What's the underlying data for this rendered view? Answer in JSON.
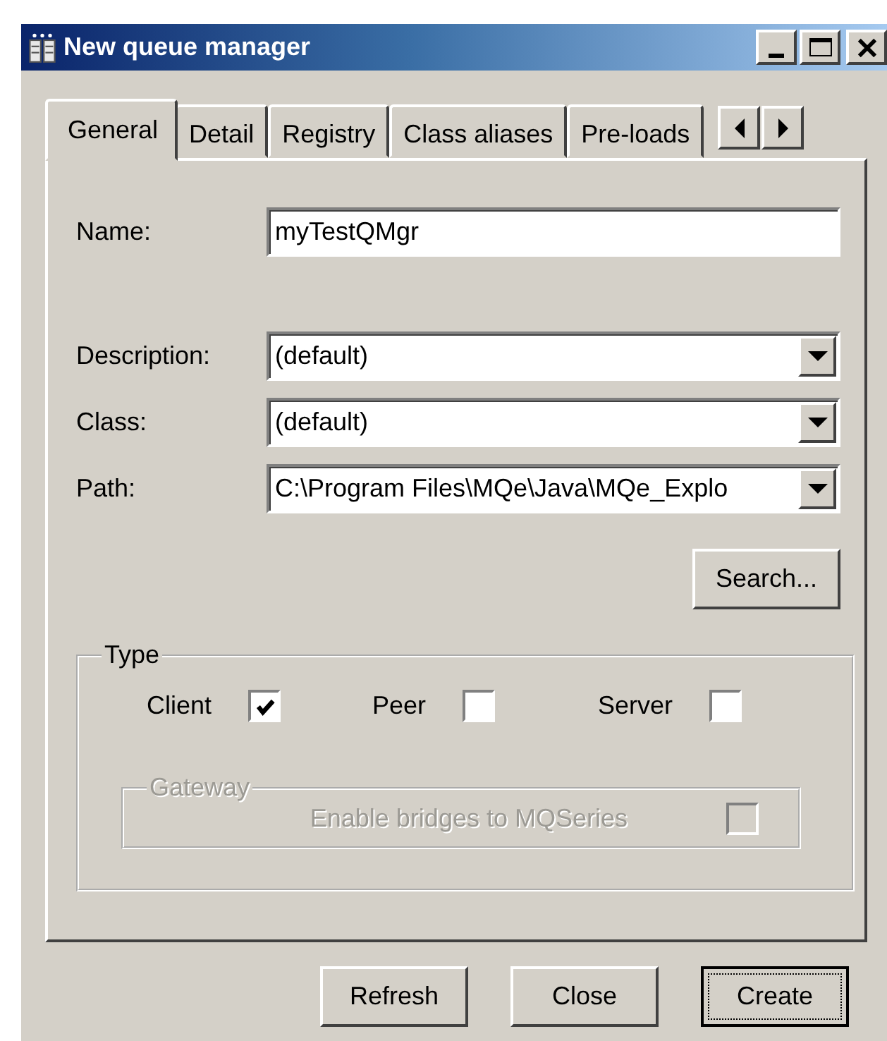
{
  "window": {
    "title": "New queue manager"
  },
  "tabs": [
    {
      "label": "General",
      "selected": true
    },
    {
      "label": "Detail",
      "selected": false
    },
    {
      "label": "Registry",
      "selected": false
    },
    {
      "label": "Class aliases",
      "selected": false
    },
    {
      "label": "Pre-loads",
      "selected": false
    }
  ],
  "name_field": {
    "label": "Name:",
    "value": "myTestQMgr"
  },
  "combos": [
    {
      "label": "Description:",
      "value": "(default)"
    },
    {
      "label": "Class:",
      "value": "(default)"
    },
    {
      "label": "Path:",
      "value": "C:\\Program Files\\MQe\\Java\\MQe_Explo"
    }
  ],
  "search_button": "Search...",
  "type_group": {
    "title": "Type",
    "options": [
      {
        "label": "Client",
        "checked": true
      },
      {
        "label": "Peer",
        "checked": false
      },
      {
        "label": "Server",
        "checked": false
      }
    ],
    "gateway": {
      "title": "Gateway",
      "disabled": true,
      "option": {
        "label": "Enable bridges to MQSeries",
        "checked": false
      }
    }
  },
  "buttons": [
    {
      "label": "Refresh",
      "default": false
    },
    {
      "label": "Close",
      "default": false
    },
    {
      "label": "Create",
      "default": true
    }
  ]
}
